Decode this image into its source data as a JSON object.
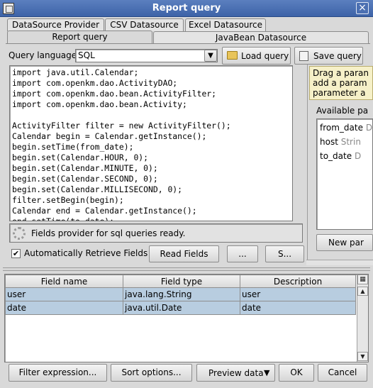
{
  "window": {
    "title": "Report query",
    "close_icon": "×"
  },
  "tabs_top": [
    "DataSource Provider",
    "CSV Datasource",
    "Excel Datasource"
  ],
  "tabs_second": [
    "Report query",
    "JavaBean Datasource"
  ],
  "query": {
    "language_label": "Query language",
    "language_value": "SQL",
    "load_label": "Load query",
    "save_label": "Save query",
    "code": "import java.util.Calendar;\nimport com.openkm.dao.ActivityDAO;\nimport com.openkm.dao.bean.ActivityFilter;\nimport com.openkm.dao.bean.Activity;\n\nActivityFilter filter = new ActivityFilter();\nCalendar begin = Calendar.getInstance();\nbegin.setTime(from_date);\nbegin.set(Calendar.HOUR, 0);\nbegin.set(Calendar.MINUTE, 0);\nbegin.set(Calendar.SECOND, 0);\nbegin.set(Calendar.MILLISECOND, 0);\nfilter.setBegin(begin);\nCalendar end = Calendar.getInstance();\nend.setTime(to_date);",
    "status": "Fields provider for sql queries ready."
  },
  "hint": {
    "lines": [
      "Drag a paran",
      "add a param",
      "parameter a"
    ]
  },
  "params": {
    "label": "Available pa",
    "items": [
      {
        "name": "from_date",
        "type": "Date"
      },
      {
        "name": "host",
        "type": "Strin"
      },
      {
        "name": "to_date",
        "type": "D"
      }
    ],
    "new_label": "New par"
  },
  "options": {
    "auto_label": "Automatically Retrieve Fields",
    "auto_checked": true,
    "read_label": "Read Fields",
    "dots_label": "...",
    "s_label": "S..."
  },
  "table": {
    "headers": [
      "Field name",
      "Field type",
      "Description"
    ],
    "rows": [
      [
        "user",
        "java.lang.String",
        "user"
      ],
      [
        "date",
        "java.util.Date",
        "date"
      ]
    ]
  },
  "footer": {
    "filter_label": "Filter expression...",
    "sort_label": "Sort options...",
    "preview_label": "Preview data",
    "ok_label": "OK",
    "cancel_label": "Cancel"
  }
}
